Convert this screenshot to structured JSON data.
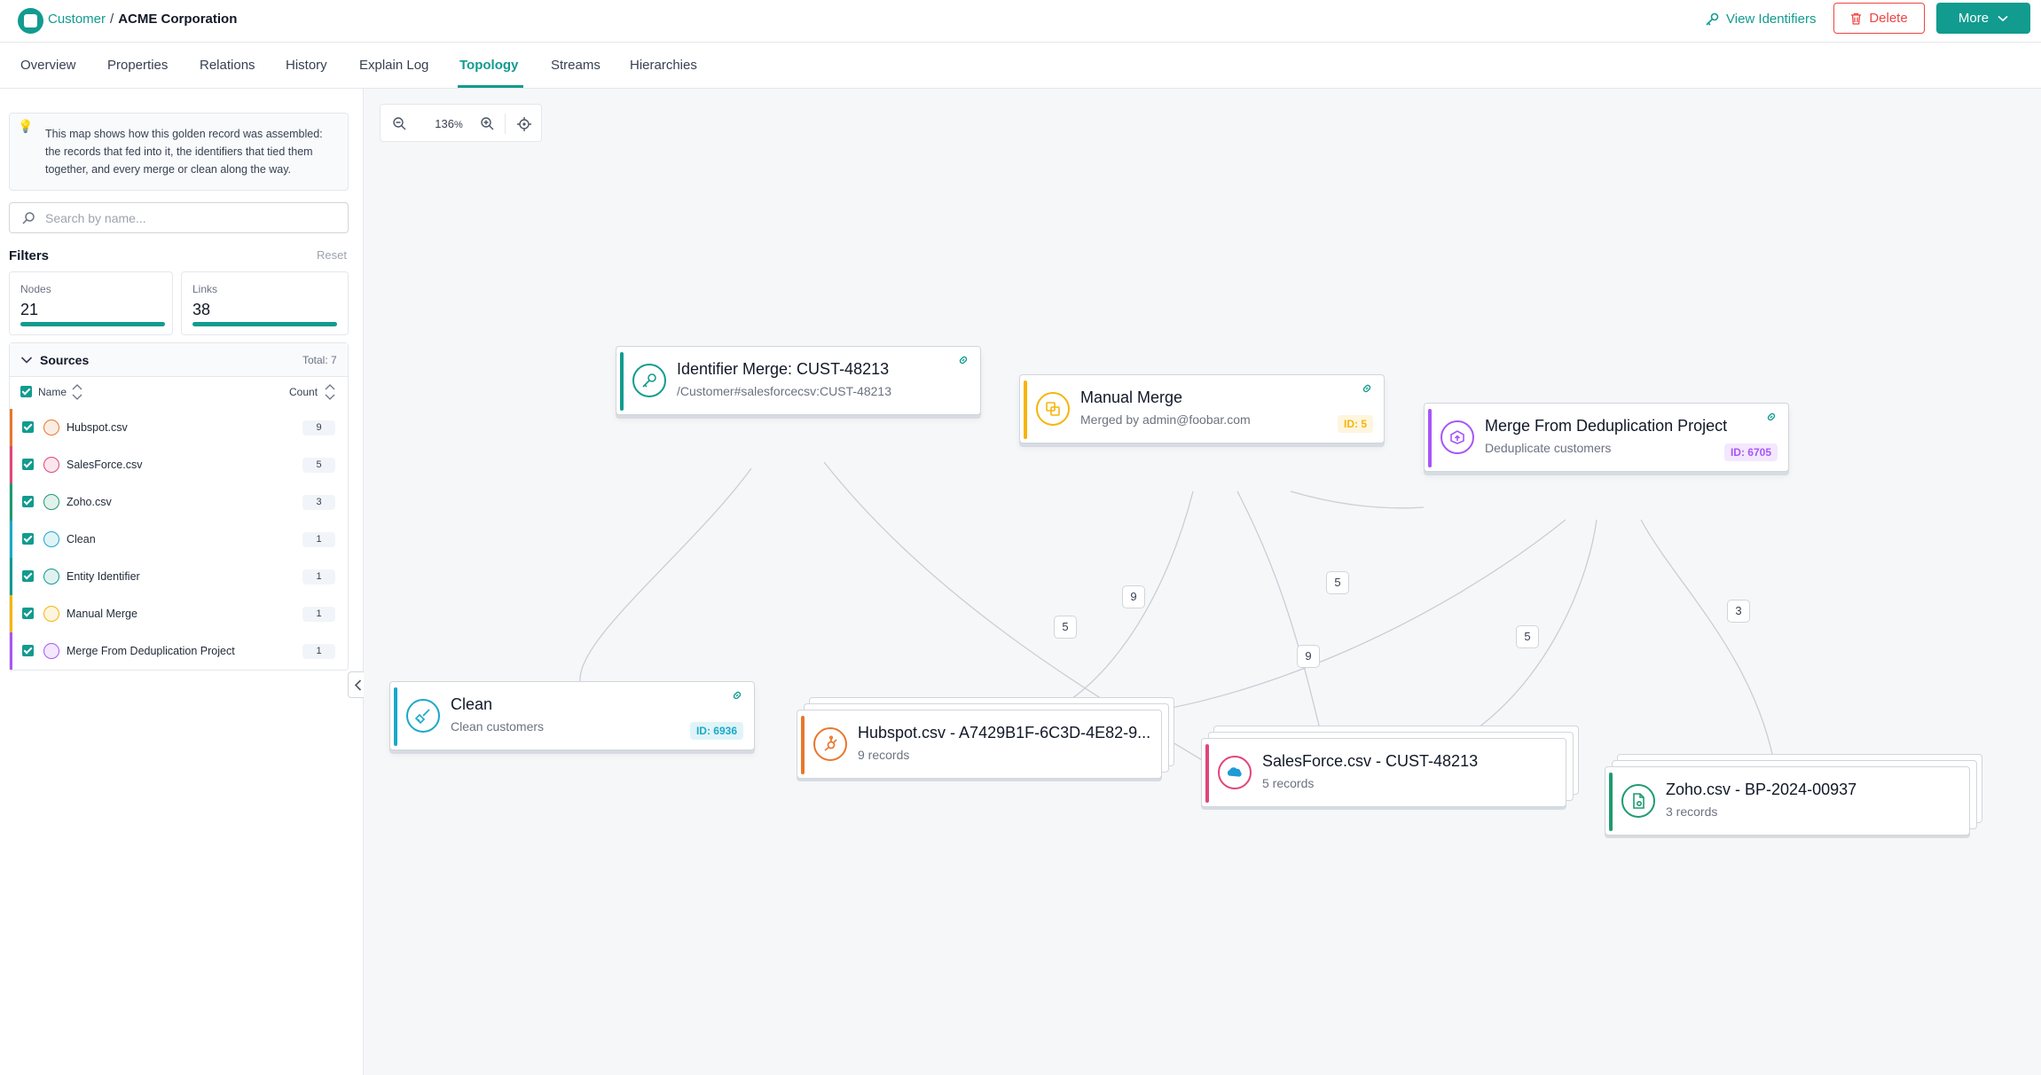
{
  "header": {
    "breadcrumb_parent": "Customer",
    "breadcrumb_sep": "/",
    "breadcrumb_current": "ACME Corporation",
    "view_identifiers_label": "View Identifiers",
    "delete_label": "Delete",
    "more_label": "More"
  },
  "tabs": [
    {
      "label": "Overview"
    },
    {
      "label": "Properties"
    },
    {
      "label": "Relations"
    },
    {
      "label": "History"
    },
    {
      "label": "Explain Log"
    },
    {
      "label": "Topology",
      "active": true
    },
    {
      "label": "Streams"
    },
    {
      "label": "Hierarchies"
    }
  ],
  "sidebar": {
    "info_text": "This map shows how this golden record was assembled: the records that fed into it, the identifiers that tied them together, and every merge or clean along the way.",
    "search_placeholder": "Search by name...",
    "filters_title": "Filters",
    "reset_label": "Reset",
    "stats": {
      "nodes_label": "Nodes",
      "nodes_value": "21",
      "nodes_fill": 1.0,
      "links_label": "Links",
      "links_value": "38",
      "links_fill": 1.0
    },
    "sources": {
      "title": "Sources",
      "total": "Total: 7",
      "col_name": "Name",
      "col_count": "Count",
      "items": [
        {
          "name": "Hubspot.csv",
          "count": "9",
          "color": "#e8772e",
          "icon": "hubspot-icon"
        },
        {
          "name": "SalesForce.csv",
          "count": "5",
          "color": "#e0457b",
          "icon": "salesforce-icon"
        },
        {
          "name": "Zoho.csv",
          "count": "3",
          "color": "#1e9b6f",
          "icon": "zoho-icon"
        },
        {
          "name": "Clean",
          "count": "1",
          "color": "#1aa9c9",
          "icon": "broom-icon"
        },
        {
          "name": "Entity Identifier",
          "count": "1",
          "color": "#129b8f",
          "icon": "key-icon"
        },
        {
          "name": "Manual Merge",
          "count": "1",
          "color": "#f5b50a",
          "icon": "merge-icon"
        },
        {
          "name": "Merge From Deduplication Project",
          "count": "1",
          "color": "#a855f7",
          "icon": "dedup-icon"
        }
      ]
    }
  },
  "canvas": {
    "zoom": "136",
    "zoom_unit": "%",
    "nodes": {
      "identifier": {
        "title": "Identifier Merge: CUST-48213",
        "subtitle": "/Customer#salesforcecsv:CUST-48213",
        "color": "#129b8f",
        "icon": "key-icon"
      },
      "manual": {
        "title": "Manual Merge",
        "subtitle": "Merged by admin@foobar.com",
        "badge": "ID: 5",
        "color": "#f5b50a",
        "icon": "merge-icon"
      },
      "dedup": {
        "title": "Merge From Deduplication Project",
        "subtitle": "Deduplicate customers",
        "badge": "ID: 6705",
        "color": "#a855f7",
        "icon": "dedup-icon"
      },
      "clean": {
        "title": "Clean",
        "subtitle": "Clean customers",
        "badge": "ID: 6936",
        "color": "#1aa9c9",
        "icon": "broom-icon"
      },
      "hubspot": {
        "title": "Hubspot.csv - A7429B1F-6C3D-4E82-9...",
        "subtitle": "9 records",
        "color": "#e8772e",
        "icon": "hubspot-icon"
      },
      "salesforce": {
        "title": "SalesForce.csv - CUST-48213",
        "subtitle": "5 records",
        "color": "#e0457b",
        "icon": "salesforce-icon"
      },
      "zoho": {
        "title": "Zoho.csv - BP-2024-00937",
        "subtitle": "3 records",
        "color": "#1e9b6f",
        "icon": "zoho-icon"
      }
    },
    "edge_labels": [
      "5",
      "9",
      "5",
      "9",
      "5",
      "3"
    ]
  }
}
